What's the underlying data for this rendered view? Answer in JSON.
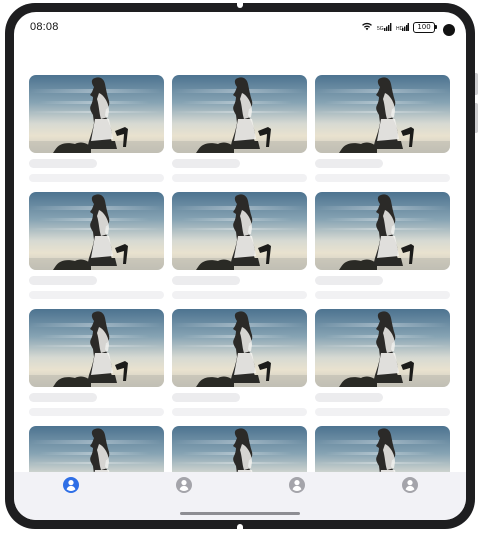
{
  "status_bar": {
    "time": "08:08",
    "battery": "100",
    "icons": [
      "wifi-icon",
      "signal-icon",
      "signal-icon",
      "battery-icon"
    ]
  },
  "gallery": {
    "image_description_icon": "silhouette-photo",
    "cards": [
      {
        "id": 1
      },
      {
        "id": 2
      },
      {
        "id": 3
      },
      {
        "id": 4
      },
      {
        "id": 5
      },
      {
        "id": 6
      },
      {
        "id": 7
      },
      {
        "id": 8
      },
      {
        "id": 9
      },
      {
        "id": 10
      },
      {
        "id": 11
      },
      {
        "id": 12
      }
    ]
  },
  "tabbar": {
    "tabs": [
      {
        "icon": "profile-icon",
        "active": true
      },
      {
        "icon": "profile-icon",
        "active": false
      },
      {
        "icon": "profile-icon",
        "active": false
      },
      {
        "icon": "profile-icon",
        "active": false
      }
    ]
  },
  "colors": {
    "accent": "#2f6fe6",
    "inactive_icon": "#a4a4aa",
    "skeleton": "#ececee",
    "tabbar_bg": "#f2f2f6"
  }
}
